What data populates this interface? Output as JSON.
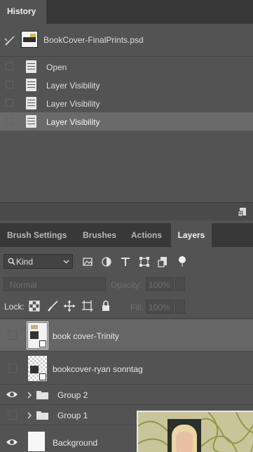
{
  "history": {
    "tab_label": "History",
    "snapshot_label": "BookCover-FinalPrints.psd",
    "items": [
      {
        "label": "Open"
      },
      {
        "label": "Layer Visibility"
      },
      {
        "label": "Layer Visibility"
      },
      {
        "label": "Layer Visibility"
      }
    ]
  },
  "layers_panel": {
    "tabs": [
      {
        "label": "Brush Settings"
      },
      {
        "label": "Brushes"
      },
      {
        "label": "Actions"
      },
      {
        "label": "Layers"
      }
    ],
    "active_tab": "Layers",
    "filter_kind": "Kind",
    "blend_mode": "Normal",
    "opacity_label": "Opacity:",
    "opacity_value": "100%",
    "lock_label": "Lock:",
    "fill_label": "Fill:",
    "fill_value": "100%",
    "layers": [
      {
        "name": "book cover-Trinity"
      },
      {
        "name": "bookcover-ryan sonntag"
      },
      {
        "name": "Group 2"
      },
      {
        "name": "Group 1"
      },
      {
        "name": "Background"
      }
    ]
  },
  "colors": {
    "panel_bg": "#535353",
    "tab_bar_bg": "#383838",
    "selected_row_bg": "#666666"
  }
}
